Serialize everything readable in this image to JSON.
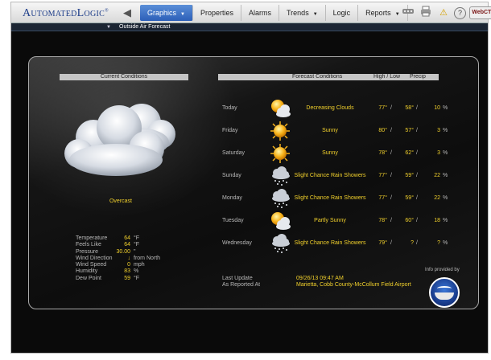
{
  "header": {
    "logo_text": "AutomatedLogic",
    "logo_mark": "®",
    "back_glyph": "◀",
    "nav": [
      {
        "label": "Graphics",
        "dropdown": true,
        "active": true
      },
      {
        "label": "Properties",
        "dropdown": false
      },
      {
        "label": "Alarms",
        "dropdown": false
      },
      {
        "label": "Trends",
        "dropdown": true
      },
      {
        "label": "Logic",
        "dropdown": false
      },
      {
        "label": "Reports",
        "dropdown": true
      }
    ],
    "caret": "▼",
    "tools": {
      "warn": "⚠",
      "help": "?",
      "brand": "WebCTRL"
    }
  },
  "pathbar": {
    "toggle": "▼",
    "label": "Outside Air Forecast"
  },
  "current": {
    "header": "Current Conditions",
    "condition": "Overcast",
    "stats": [
      {
        "label": "Temperature",
        "value": "64",
        "unit": "°F"
      },
      {
        "label": "Feels Like",
        "value": "64",
        "unit": "°F"
      },
      {
        "label": "Pressure",
        "value": "30.00",
        "unit": "\""
      },
      {
        "label": "Wind Direction",
        "value": "↓",
        "unit": "from North"
      },
      {
        "label": "Wind Speed",
        "value": "0",
        "unit": "mph"
      },
      {
        "label": "Humidity",
        "value": "83",
        "unit": "%"
      },
      {
        "label": "Dew Point",
        "value": "59",
        "unit": "°F"
      }
    ]
  },
  "forecast": {
    "header": "Forecast Conditions",
    "high_low_header": "High / Low",
    "precip_header": "Precip",
    "slash": "/",
    "pct": "%",
    "rows": [
      {
        "day": "Today",
        "icon": "partly-cloudy-icon",
        "desc": "Decreasing Clouds",
        "high": "77°",
        "low": "58°",
        "precip": "10"
      },
      {
        "day": "Friday",
        "icon": "sun-icon",
        "desc": "Sunny",
        "high": "80°",
        "low": "57°",
        "precip": "3"
      },
      {
        "day": "Saturday",
        "icon": "sun-icon",
        "desc": "Sunny",
        "high": "78°",
        "low": "62°",
        "precip": "3"
      },
      {
        "day": "Sunday",
        "icon": "rain-icon",
        "desc": "Slight Chance Rain Showers",
        "high": "77°",
        "low": "59°",
        "precip": "22"
      },
      {
        "day": "Monday",
        "icon": "rain-icon",
        "desc": "Slight Chance Rain Showers",
        "high": "77°",
        "low": "59°",
        "precip": "22"
      },
      {
        "day": "Tuesday",
        "icon": "partly-cloudy-icon",
        "desc": "Partly Sunny",
        "high": "78°",
        "low": "60°",
        "precip": "18"
      },
      {
        "day": "Wednesday",
        "icon": "rain-icon",
        "desc": "Slight Chance Rain Showers",
        "high": "79°",
        "low": "?",
        "precip": "?"
      }
    ]
  },
  "update": {
    "last_update_label": "Last Update",
    "last_update_value": "09/26/13 09:47 AM",
    "reported_label": "As Reported At",
    "reported_value": "Marietta, Cobb County-McCollum Field Airport"
  },
  "attribution": {
    "label": "Info provided by"
  }
}
